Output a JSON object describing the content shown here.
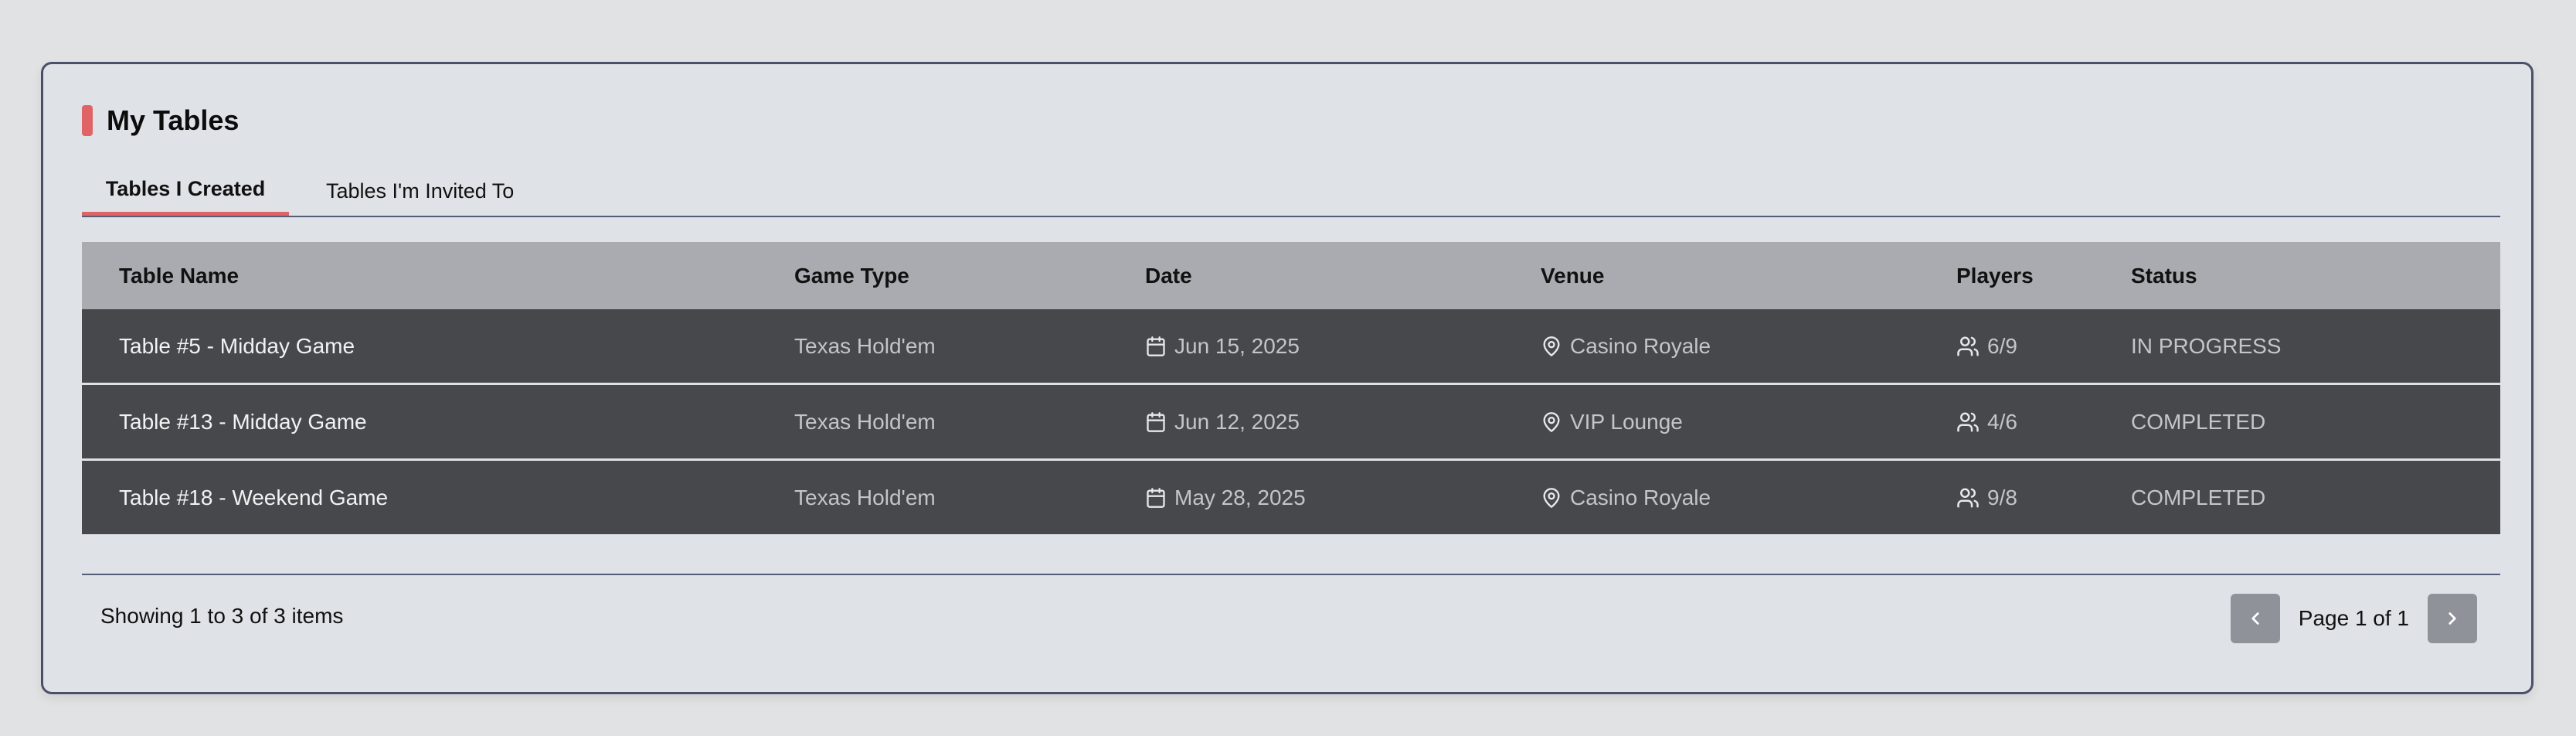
{
  "card": {
    "title": "My Tables"
  },
  "tabs": [
    {
      "label": "Tables I Created",
      "active": true
    },
    {
      "label": "Tables I'm Invited To",
      "active": false
    }
  ],
  "table": {
    "columns": [
      "Table Name",
      "Game Type",
      "Date",
      "Venue",
      "Players",
      "Status"
    ],
    "rows": [
      {
        "name": "Table #5 - Midday Game",
        "game": "Texas Hold'em",
        "date": "Jun 15, 2025",
        "venue": "Casino Royale",
        "players": "6/9",
        "status": "IN PROGRESS"
      },
      {
        "name": "Table #13 - Midday Game",
        "game": "Texas Hold'em",
        "date": "Jun 12, 2025",
        "venue": "VIP Lounge",
        "players": "4/6",
        "status": "COMPLETED"
      },
      {
        "name": "Table #18 - Weekend Game",
        "game": "Texas Hold'em",
        "date": "May 28, 2025",
        "venue": "Casino Royale",
        "players": "9/8",
        "status": "COMPLETED"
      }
    ]
  },
  "footer": {
    "showing": "Showing 1 to 3 of 3 items",
    "page": "Page 1 of 1"
  },
  "icons": {
    "date": "calendar-icon",
    "venue": "map-pin-icon",
    "players": "users-icon",
    "prev": "chevron-left-icon",
    "next": "chevron-right-icon"
  },
  "colors": {
    "accent": "#e06466",
    "header_bg": "#a9abb0",
    "row_bg": "#47484c",
    "card_border": "#4a5068"
  }
}
